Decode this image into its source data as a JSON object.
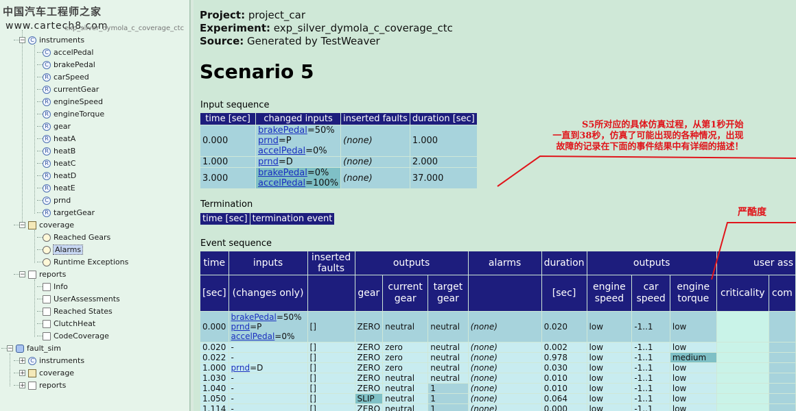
{
  "watermark": {
    "text": "中国汽车工程师之家",
    "url": "www.cartech8.com",
    "partial_item": "exp_silver_dymola_c_coverage_ctc"
  },
  "tree": {
    "instruments_label": "instruments",
    "instrument_items": [
      {
        "label": "accelPedal",
        "badge": "C"
      },
      {
        "label": "brakePedal",
        "badge": "C"
      },
      {
        "label": "carSpeed",
        "badge": "R"
      },
      {
        "label": "currentGear",
        "badge": "R"
      },
      {
        "label": "engineSpeed",
        "badge": "R"
      },
      {
        "label": "engineTorque",
        "badge": "R"
      },
      {
        "label": "gear",
        "badge": "R"
      },
      {
        "label": "heatA",
        "badge": "R"
      },
      {
        "label": "heatB",
        "badge": "R"
      },
      {
        "label": "heatC",
        "badge": "R"
      },
      {
        "label": "heatD",
        "badge": "R"
      },
      {
        "label": "heatE",
        "badge": "R"
      },
      {
        "label": "prnd",
        "badge": "C"
      },
      {
        "label": "targetGear",
        "badge": "R"
      }
    ],
    "coverage_label": "coverage",
    "coverage_items": [
      "Reached Gears",
      "Alarms",
      "Runtime Exceptions"
    ],
    "reports_label": "reports",
    "reports_items": [
      "Info",
      "UserAssessments",
      "Reached States",
      "ClutchHeat",
      "CodeCoverage"
    ],
    "fault_sim_label": "fault_sim",
    "fault_sim_items": [
      "instruments",
      "coverage",
      "reports"
    ]
  },
  "meta": {
    "project_key": "Project:",
    "project_val": " project_car",
    "experiment_key": "Experiment:",
    "experiment_val": " exp_silver_dymola_c_coverage_ctc",
    "source_key": "Source:",
    "source_val": " Generated by TestWeaver"
  },
  "scenario_title": "Scenario 5",
  "input_sequence": {
    "label": "Input sequence",
    "headers": [
      "time [sec]",
      "changed inputs",
      "inserted faults",
      "duration [sec]"
    ],
    "rows": [
      {
        "time": "0.000",
        "inputs": [
          {
            "name": "brakePedal",
            "val": "=50%"
          },
          {
            "name": "prnd",
            "val": "=P"
          },
          {
            "name": "accelPedal",
            "val": "=0%"
          }
        ],
        "faults": "(none)",
        "duration": "1.000"
      },
      {
        "time": "1.000",
        "inputs": [
          {
            "name": "prnd",
            "val": "=D"
          }
        ],
        "faults": "(none)",
        "duration": "2.000"
      },
      {
        "time": "3.000",
        "inputs": [
          {
            "name": "brakePedal",
            "val": "=0%"
          },
          {
            "name": "accelPedal",
            "val": "=100%"
          }
        ],
        "faults": "(none)",
        "duration": "37.000"
      }
    ]
  },
  "termination": {
    "label": "Termination",
    "headers": [
      "time [sec]",
      "termination event"
    ]
  },
  "event_sequence": {
    "label": "Event sequence",
    "header1": [
      "time",
      "inputs",
      "inserted faults",
      "outputs",
      "alarms",
      "duration",
      "outputs",
      "user ass"
    ],
    "header2": [
      "[sec]",
      "(changes only)",
      "",
      "gear",
      "current gear",
      "target gear",
      "",
      "[sec]",
      "engine speed",
      "car speed",
      "engine torque",
      "criticality",
      "com"
    ],
    "rows": [
      {
        "time": "0.000",
        "inputs": [
          {
            "name": "brakePedal",
            "val": "=50%"
          },
          {
            "name": "prnd",
            "val": "=P"
          },
          {
            "name": "accelPedal",
            "val": "=0%"
          }
        ],
        "faults": "[]",
        "gear": "ZERO",
        "cur": "neutral",
        "tgt": "neutral",
        "alarms": "(none)",
        "dur": "0.020",
        "es": "low",
        "cs": "-1..1",
        "et": "low"
      },
      {
        "time": "0.020",
        "inputs": [
          {
            "name": "",
            "val": "-"
          }
        ],
        "faults": "[]",
        "gear": "ZERO",
        "cur": "zero",
        "tgt": "neutral",
        "alarms": "(none)",
        "dur": "0.002",
        "es": "low",
        "cs": "-1..1",
        "et": "low"
      },
      {
        "time": "0.022",
        "inputs": [
          {
            "name": "",
            "val": "-"
          }
        ],
        "faults": "[]",
        "gear": "ZERO",
        "cur": "zero",
        "tgt": "neutral",
        "alarms": "(none)",
        "dur": "0.978",
        "es": "low",
        "cs": "-1..1",
        "et": "medium"
      },
      {
        "time": "1.000",
        "inputs": [
          {
            "name": "prnd",
            "val": "=D"
          }
        ],
        "faults": "[]",
        "gear": "ZERO",
        "cur": "zero",
        "tgt": "neutral",
        "alarms": "(none)",
        "dur": "0.030",
        "es": "low",
        "cs": "-1..1",
        "et": "low"
      },
      {
        "time": "1.030",
        "inputs": [
          {
            "name": "",
            "val": "-"
          }
        ],
        "faults": "[]",
        "gear": "ZERO",
        "cur": "neutral",
        "tgt": "neutral",
        "alarms": "(none)",
        "dur": "0.010",
        "es": "low",
        "cs": "-1..1",
        "et": "low"
      },
      {
        "time": "1.040",
        "inputs": [
          {
            "name": "",
            "val": "-"
          }
        ],
        "faults": "[]",
        "gear": "ZERO",
        "cur": "neutral",
        "tgt": "1",
        "alarms": "(none)",
        "dur": "0.010",
        "es": "low",
        "cs": "-1..1",
        "et": "low"
      },
      {
        "time": "1.050",
        "inputs": [
          {
            "name": "",
            "val": "-"
          }
        ],
        "faults": "[]",
        "gear": "SLIP",
        "cur": "neutral",
        "tgt": "1",
        "alarms": "(none)",
        "dur": "0.064",
        "es": "low",
        "cs": "-1..1",
        "et": "low"
      },
      {
        "time": "1.114",
        "inputs": [
          {
            "name": "",
            "val": "-"
          }
        ],
        "faults": "[]",
        "gear": "ZERO",
        "cur": "neutral",
        "tgt": "1",
        "alarms": "(none)",
        "dur": "0.000",
        "es": "low",
        "cs": "-1..1",
        "et": "low"
      }
    ]
  },
  "annotations": {
    "note_lines": [
      "S5所对应的具体仿真过程，从第1秒开始",
      "一直到38秒，仿真了可能出现的各种情况，出现",
      "故障的记录在下面的事件结果中有详细的描述！"
    ],
    "severity": "严酷度"
  },
  "colors": {
    "header": "#1d1d7d",
    "annotation": "#e0141a",
    "background": "#cfe8d7"
  }
}
